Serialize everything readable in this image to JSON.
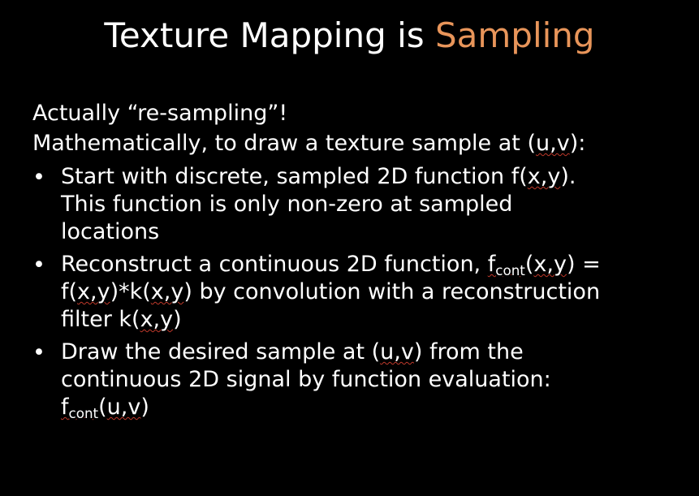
{
  "slide": {
    "title_prefix": "Texture Mapping is ",
    "title_highlight": "Sampling",
    "highlight_color": "#e8955a",
    "lines": {
      "intro": "Actually “re-sampling”!",
      "math_prefix": "Mathematically, to draw a texture sample at (",
      "math_uv": "u,v",
      "math_suffix": "):"
    },
    "bullets": [
      {
        "dot": "•",
        "b1_l1_pre": "Start with discrete, sampled 2D function f(",
        "b1_l1_xy": "x,y",
        "b1_l1_post": ").",
        "b1_l2": "This function is only non-zero at sampled",
        "b1_l3": "locations"
      },
      {
        "dot": "•",
        "b2_l1_pre": "Reconstruct a continuous 2D function, ",
        "b2_f": "f",
        "b2_sub": "cont",
        "b2_l1_open": "(",
        "b2_l1_xy": "x,y",
        "b2_l1_post": ") =",
        "b2_l2_a": "f(",
        "b2_l2_xy1": "x,y",
        "b2_l2_b": ")*k(",
        "b2_l2_xy2": "x,y",
        "b2_l2_c": ") by convolution with a reconstruction",
        "b2_l3_a": "filter k(",
        "b2_l3_xy": "x,y",
        "b2_l3_b": ")"
      },
      {
        "dot": "•",
        "b3_l1_pre": "Draw the desired sample at (",
        "b3_l1_uv": "u,v",
        "b3_l1_post": ") from the",
        "b3_l2": "continuous 2D signal by function evaluation:",
        "b3_f": "f",
        "b3_sub": "cont",
        "b3_open": "(",
        "b3_uv": "u,v",
        "b3_close": ")"
      }
    ]
  }
}
